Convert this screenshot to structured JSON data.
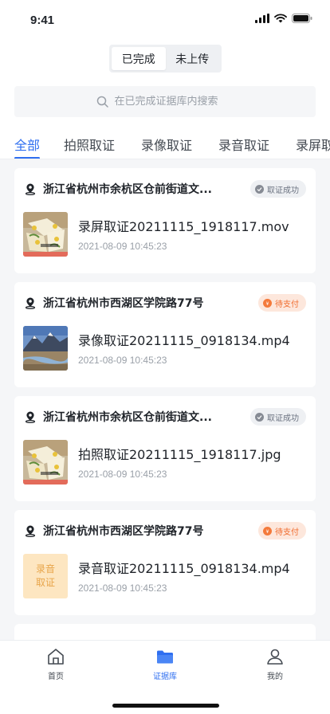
{
  "status_bar": {
    "time": "9:41"
  },
  "segmented": {
    "completed": "已完成",
    "not_uploaded": "未上传"
  },
  "search": {
    "placeholder": "在已完成证据库内搜索"
  },
  "tabs": [
    "全部",
    "拍照取证",
    "录像取证",
    "录音取证",
    "录屏取"
  ],
  "records": [
    {
      "address": "浙江省杭州市余杭区仓前街道文...",
      "status": "取证成功",
      "status_type": "success",
      "thumb": "cake-photo",
      "file_name": "录屏取证20211115_1918117.mov",
      "time": "2021-08-09 10:45:23"
    },
    {
      "address": "浙江省杭州市西湖区学院路77号",
      "status": "待支付",
      "status_type": "pending",
      "thumb": "mountain-photo",
      "file_name": "录像取证20211115_0918134.mp4",
      "time": "2021-08-09 10:45:23"
    },
    {
      "address": "浙江省杭州市余杭区仓前街道文...",
      "status": "取证成功",
      "status_type": "success",
      "thumb": "cake-photo",
      "file_name": "拍照取证20211115_1918117.jpg",
      "time": "2021-08-09 10:45:23"
    },
    {
      "address": "浙江省杭州市西湖区学院路77号",
      "status": "待支付",
      "status_type": "pending",
      "thumb": "audio-tile",
      "thumb_label_1": "录音",
      "thumb_label_2": "取证",
      "file_name": "录音取证20211115_0918134.mp4",
      "time": "2021-08-09 10:45:23"
    }
  ],
  "bottom_nav": {
    "home": "首页",
    "evidence": "证据库",
    "mine": "我的"
  },
  "colors": {
    "accent": "#2f6ff0",
    "pending": "#f06b2d",
    "success": "#868b94"
  }
}
